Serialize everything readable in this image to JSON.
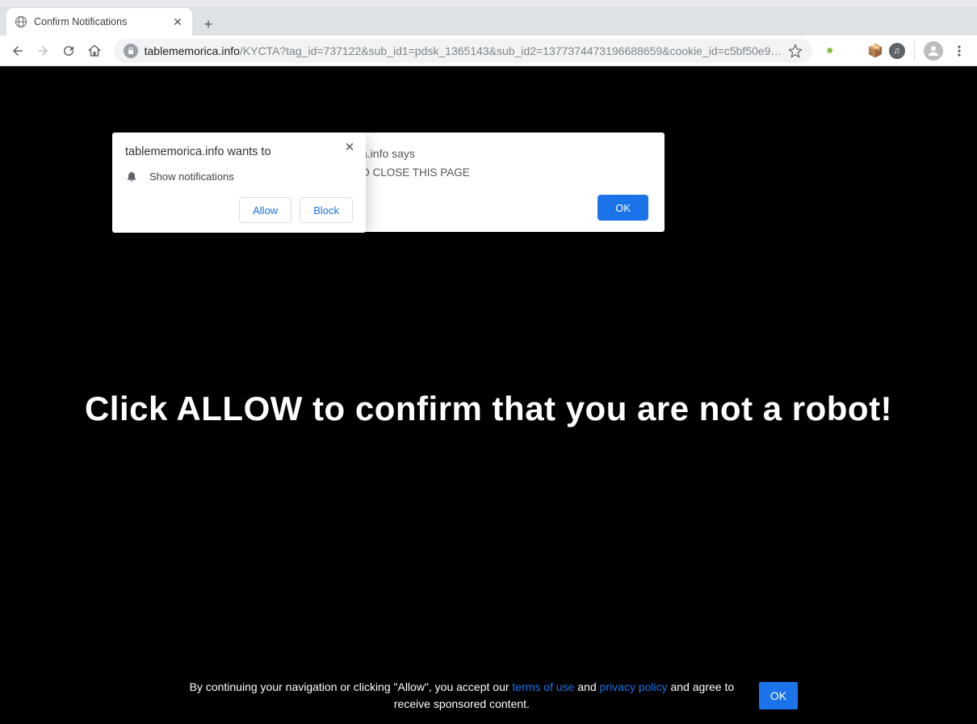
{
  "window": {
    "tab_title": "Confirm Notifications"
  },
  "toolbar": {
    "url_host": "tablememorica.info",
    "url_path": "/KYCTA?tag_id=737122&sub_id1=pdsk_1365143&sub_id2=1377374473196688659&cookie_id=c5bf50e9…"
  },
  "perm": {
    "title": "tablememorica.info wants to",
    "row_label": "Show notifications",
    "allow": "Allow",
    "block": "Block"
  },
  "alert": {
    "title": "emorica.info says",
    "body": "LOW TO CLOSE THIS PAGE",
    "ok": "OK"
  },
  "page": {
    "headline": "Click ALLOW to confirm that you are not a robot!"
  },
  "footer": {
    "pre": "By continuing your navigation or clicking \"Allow\", you accept our ",
    "terms": "terms of use",
    "mid": " and ",
    "privacy": "privacy policy",
    "post": " and agree to receive sponsored content.",
    "ok": "OK"
  }
}
